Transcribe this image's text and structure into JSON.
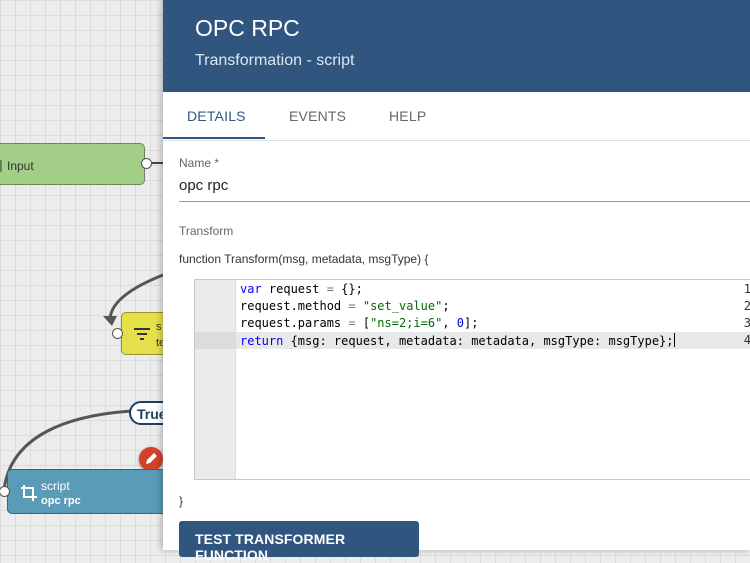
{
  "canvas": {
    "input_node_label": "Input",
    "switch_node_label_1": "s",
    "switch_node_label_2": "te",
    "script_node_type": "script",
    "script_node_name": "opc rpc",
    "true_badge": "True"
  },
  "panel": {
    "title": "OPC RPC",
    "subtitle": "Transformation - script",
    "tabs": [
      "DETAILS",
      "EVENTS",
      "HELP"
    ],
    "active_tab": "DETAILS",
    "name_label": "Name *",
    "name_value": "opc rpc",
    "transform_label": "Transform",
    "function_signature": "function Transform(msg, metadata, msgType) {",
    "function_close": "}",
    "code_lines": [
      "var request = {};",
      "request.method = \"set_value\";",
      "request.params = [\"ns=2;i=6\", 0];",
      "return {msg: request, metadata: metadata, msgType: msgType};"
    ],
    "line_numbers": [
      "1",
      "2",
      "3",
      "4"
    ],
    "test_button": "TEST TRANSFORMER FUNCTION"
  },
  "colors": {
    "header": "#305680",
    "input_node": "#a3ce87",
    "switch_node": "#e6e04b",
    "script_node": "#5a9bb8",
    "edit_fab": "#d4412b"
  }
}
